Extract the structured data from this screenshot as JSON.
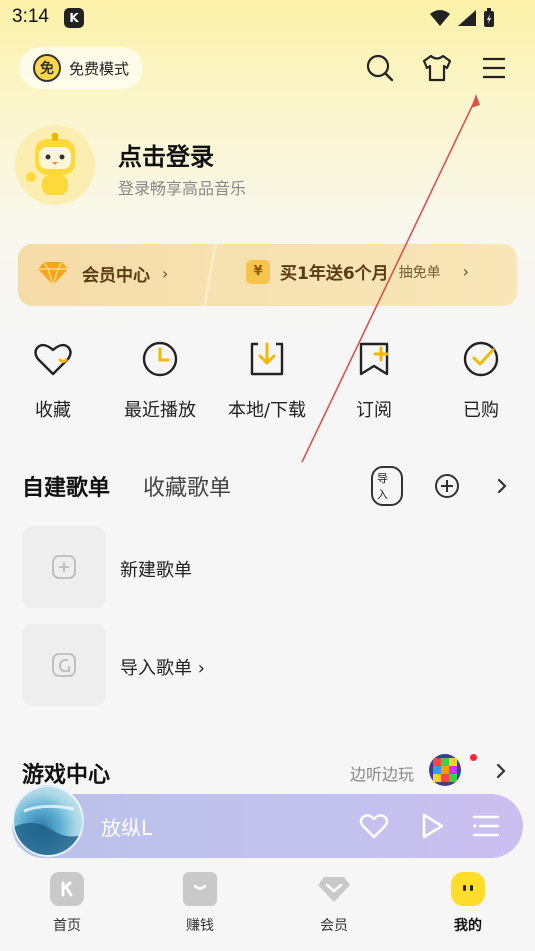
{
  "status_bar": {
    "time": "3:14",
    "app_badge": "K"
  },
  "header": {
    "mode_badge": "免",
    "mode_label": "免费模式",
    "icons": [
      "search-icon",
      "skin-icon",
      "menu-icon"
    ]
  },
  "profile": {
    "title": "点击登录",
    "subtitle": "登录畅享高品音乐"
  },
  "vip": {
    "center_label": "会员中心",
    "offer_text": "买1年送6个月",
    "offer_badge": "¥",
    "draw_text": "抽免单"
  },
  "quick_actions": [
    {
      "label": "收藏",
      "icon": "heart-icon"
    },
    {
      "label": "最近播放",
      "icon": "clock-icon"
    },
    {
      "label": "本地/下载",
      "icon": "download-icon"
    },
    {
      "label": "订阅",
      "icon": "subscribe-icon"
    },
    {
      "label": "已购",
      "icon": "purchased-icon"
    }
  ],
  "playlists": {
    "tab_active": "自建歌单",
    "tab_inactive": "收藏歌单",
    "import_badge": "导入",
    "rows": [
      {
        "label": "新建歌单"
      },
      {
        "label": "导入歌单 ›"
      }
    ]
  },
  "game": {
    "title": "游戏中心",
    "subtitle": "边听边玩"
  },
  "player": {
    "title": "放纵L"
  },
  "nav": {
    "items": [
      {
        "label": "首页"
      },
      {
        "label": "赚钱"
      },
      {
        "label": "会员"
      },
      {
        "label": "我的"
      }
    ]
  },
  "colors": {
    "accent": "#f5c518",
    "vip_text": "#5b3b12",
    "annotation": "#d9534f"
  }
}
